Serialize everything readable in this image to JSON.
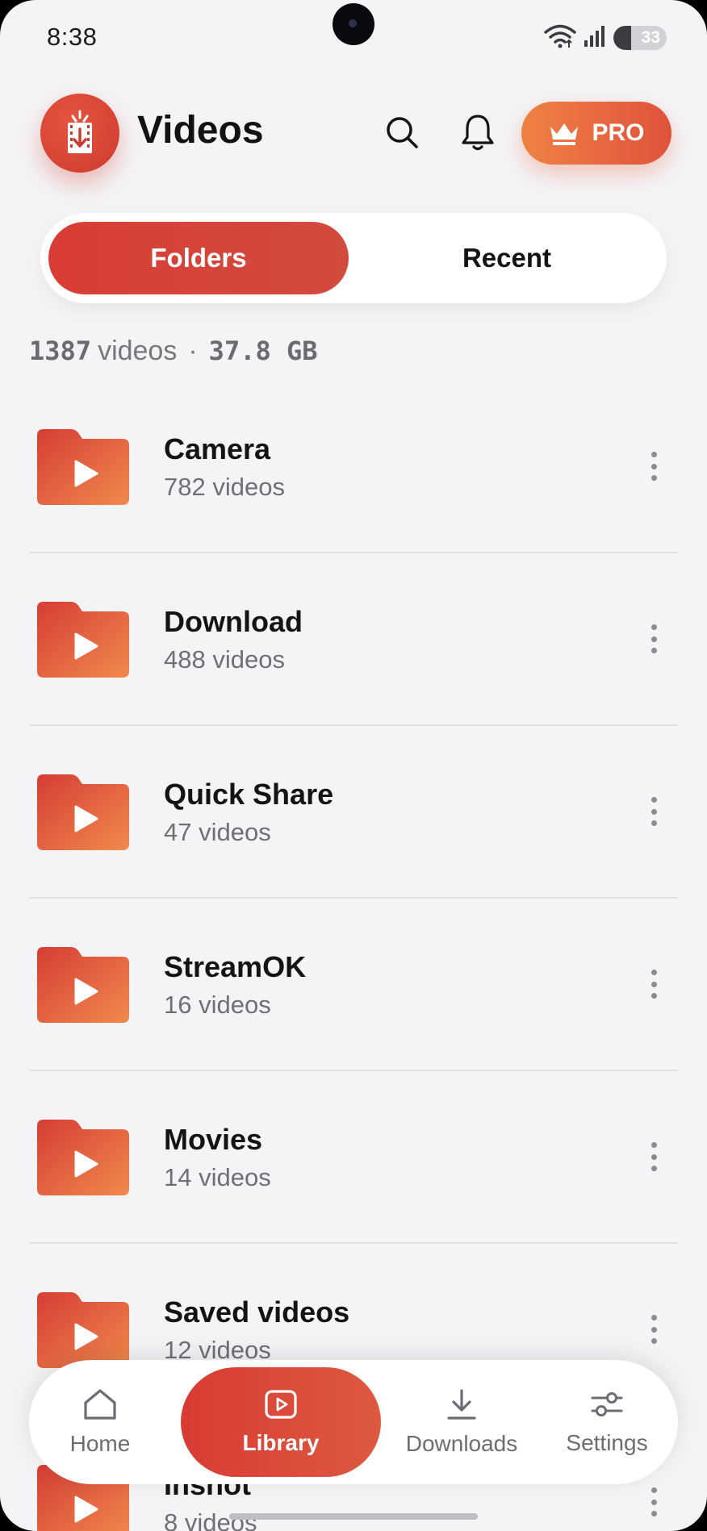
{
  "status_bar": {
    "time": "8:38",
    "battery": "33",
    "battery_level": 0.33
  },
  "header": {
    "title": "Videos",
    "pro_label": "PRO"
  },
  "tabs": [
    {
      "label": "Folders",
      "active": true
    },
    {
      "label": "Recent",
      "active": false
    }
  ],
  "summary": {
    "count": "1387",
    "count_unit": "videos",
    "separator": "·",
    "size": "37.8 GB"
  },
  "folders": [
    {
      "name": "Camera",
      "count": "782 videos"
    },
    {
      "name": "Download",
      "count": "488 videos"
    },
    {
      "name": "Quick Share",
      "count": "47 videos"
    },
    {
      "name": "StreamOK",
      "count": "16 videos"
    },
    {
      "name": "Movies",
      "count": "14 videos"
    },
    {
      "name": "Saved videos",
      "count": "12 videos"
    },
    {
      "name": "Inshot",
      "count": "8 videos"
    }
  ],
  "bottom_nav": [
    {
      "label": "Home",
      "icon": "home-icon",
      "active": false
    },
    {
      "label": "Library",
      "icon": "play-square-icon",
      "active": true
    },
    {
      "label": "Downloads",
      "icon": "download-icon",
      "active": false
    },
    {
      "label": "Settings",
      "icon": "sliders-icon",
      "active": false
    }
  ],
  "colors": {
    "accent": "#d83d35",
    "accent_orange": "#ef8245",
    "background": "#f4f4f7",
    "text_primary": "#141416",
    "text_secondary": "#6f6f75"
  }
}
